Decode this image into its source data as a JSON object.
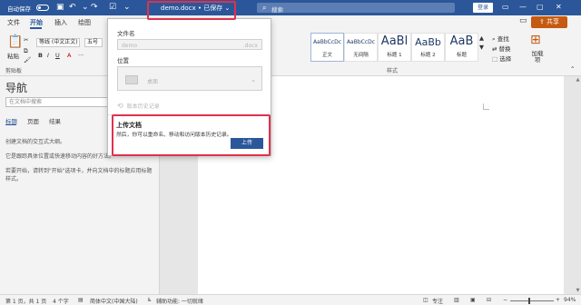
{
  "titlebar": {
    "autosave_label": "自动保存",
    "autosave_state": "off",
    "doc_title": "demo.docx • 已保存 ⌄",
    "search_placeholder": "搜索",
    "login_label": "登录"
  },
  "tabs": {
    "items": [
      "文件",
      "开始",
      "插入",
      "绘图"
    ],
    "active": "开始"
  },
  "share": {
    "label": "共享"
  },
  "ribbon": {
    "paste_label": "粘贴",
    "clipboard_label": "剪贴板",
    "font_name": "等线 (中文正文)",
    "font_size": "五号",
    "styles_label": "样式",
    "styles": [
      {
        "preview": "AaBbCcDc",
        "name": "正文"
      },
      {
        "preview": "AaBbCcDc",
        "name": "无间隔"
      },
      {
        "preview": "AaBl",
        "name": "标题 1"
      },
      {
        "preview": "AaBb",
        "name": "标题 2"
      },
      {
        "preview": "AaB",
        "name": "标题"
      }
    ],
    "find_label": "查找",
    "replace_label": "替换",
    "select_label": "选择",
    "addins_label": "加载项"
  },
  "nav": {
    "title": "导航",
    "search_placeholder": "在文档中搜索",
    "tabs": [
      "标题",
      "页面",
      "结果"
    ],
    "lines": [
      "创建文档的交互式大纲。",
      "它是跟踪具体位置或快速移动内容的好方法。",
      "若要开始，请转到\"开始\"选项卡，并向文档中的标题应用标题样式。"
    ]
  },
  "popup": {
    "filename_label": "文件名",
    "filename_value": "demo",
    "filename_ext": ".docx",
    "location_label": "位置",
    "location_value": "桌面",
    "history_label": "版本历史记录",
    "upload_title": "上传文档",
    "upload_desc": "然后，你可以重命名、移动和访问版本历史记录。",
    "upload_button": "上传"
  },
  "statusbar": {
    "page": "第 1 页，共 1 页",
    "words": "4 个字",
    "language": "简体中文(中国大陆)",
    "accessibility": "辅助功能: 一切就绪",
    "focus": "专注",
    "zoom": "94%"
  },
  "colors": {
    "brand": "#2b579a",
    "share": "#c55a11",
    "highlight": "#e0314b"
  }
}
